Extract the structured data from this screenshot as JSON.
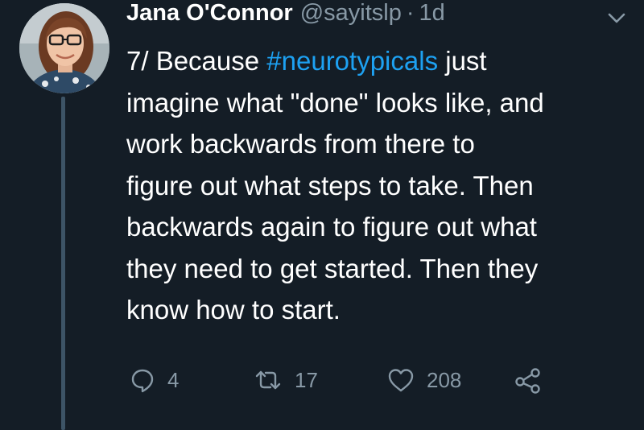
{
  "author": {
    "display_name": "Jana O'Connor",
    "handle": "@sayitslp",
    "separator": "·",
    "time": "1d"
  },
  "tweet": {
    "lines": [
      {
        "prefix": "7/ Because ",
        "hashtag": "#neurotypicals",
        "suffix": " just"
      },
      {
        "text": "imagine what \"done\" looks like, and"
      },
      {
        "text": "work backwards from there to"
      },
      {
        "text": "figure out what steps to take. Then"
      },
      {
        "text": "backwards again to figure out what"
      },
      {
        "text": "they need to get started. Then they"
      },
      {
        "text": "know how to start."
      }
    ]
  },
  "actions": {
    "reply_count": "4",
    "retweet_count": "17",
    "like_count": "208"
  },
  "icons": {
    "reply": "reply-icon",
    "retweet": "retweet-icon",
    "like": "heart-icon",
    "share": "share-icon",
    "caret": "chevron-down-icon"
  },
  "colors": {
    "background": "#141d26",
    "text": "#ffffff",
    "muted": "#8899a6",
    "hashtag": "#1da1f2",
    "thread_line": "#3d5466"
  }
}
